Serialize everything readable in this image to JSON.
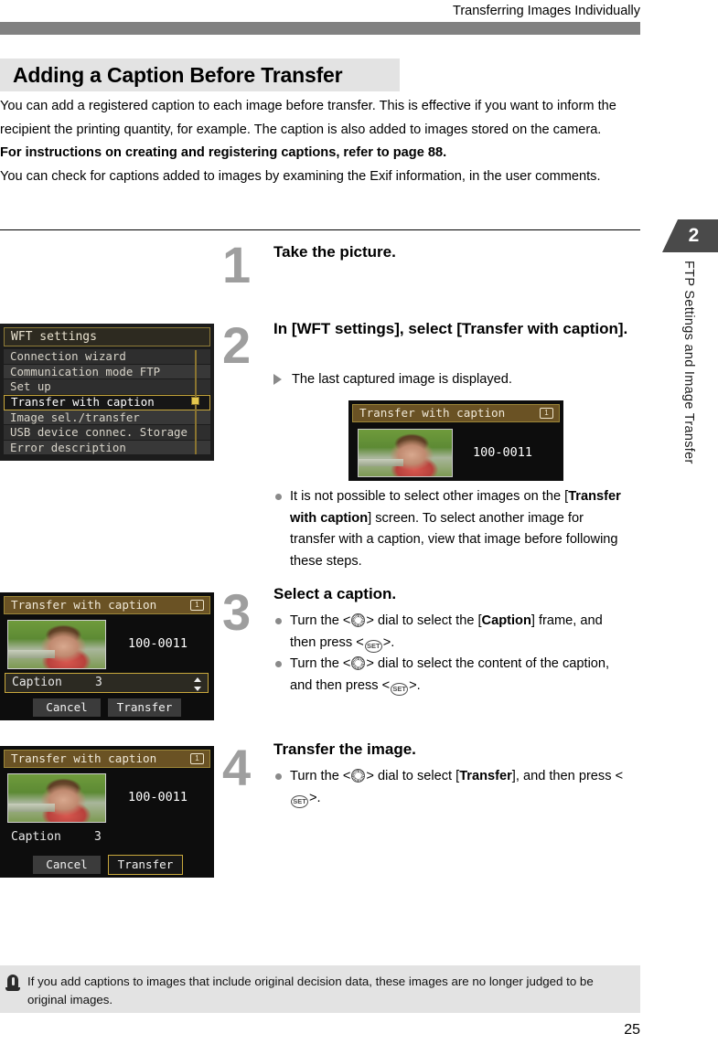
{
  "header": {
    "running_title": "Transferring Images Individually",
    "rule_color": "#818181"
  },
  "side_tab": {
    "chapter_number": "2",
    "chapter_label": "FTP Settings and Image Transfer",
    "bg_color": "#4a4a4a"
  },
  "section": {
    "heading": "Adding a Caption Before Transfer",
    "heading_bg": "#e3e3e3"
  },
  "intro": {
    "line1": "You can add a registered caption to each image before transfer. This is effective if you want to inform the recipient the printing quantity, for example. The caption is also added to images stored on the camera.",
    "line2_bold": "For instructions on creating and registering captions, refer to page 88.",
    "line3": "You can check for captions added to images by examining the Exif information, in the user comments."
  },
  "steps": [
    {
      "number": "1",
      "title": "Take the picture."
    },
    {
      "number": "2",
      "title_part1": "In [WFT settings], select [Transfer with caption].",
      "arrow_note": "The last captured image is displayed.",
      "bullet_pre": "It is not possible to select other images on the [",
      "bullet_bold": "Transfer with caption",
      "bullet_post": "] screen. To select another image for transfer with a caption, view that image before following these steps."
    },
    {
      "number": "3",
      "title": "Select a caption.",
      "bullet1_a": "Turn the <",
      "bullet1_b": "> dial to select the [",
      "bullet1_bold": "Caption",
      "bullet1_c": "] frame, and then press <",
      "bullet1_d": ">.",
      "bullet2_a": "Turn the <",
      "bullet2_b": "> dial to select the content of the caption, and then press <",
      "bullet2_c": ">."
    },
    {
      "number": "4",
      "title": "Transfer the image.",
      "bullet1_a": "Turn the <",
      "bullet1_b": "> dial to select [",
      "bullet1_bold": "Transfer",
      "bullet1_c": "], and then press <",
      "bullet1_d": ">."
    }
  ],
  "icons": {
    "dial": "quick-control-dial-icon",
    "set": "SET",
    "card_badge": "1",
    "warning": "warning-bell-icon"
  },
  "lcd_wft": {
    "menu_title": "WFT settings",
    "items": [
      "Connection wizard",
      "Communication mode FTP",
      "Set up",
      "Transfer with caption",
      "Image sel./transfer",
      "USB device connec. Storage",
      "Error description"
    ],
    "selected_index": 3,
    "highlight_color": "#c9a83c"
  },
  "lcd_step2": {
    "title": "Transfer with caption",
    "card_badge": "1",
    "filename": "100-0011"
  },
  "lcd_step3": {
    "title": "Transfer with caption",
    "card_badge": "1",
    "filename": "100-0011",
    "caption_label": "Caption",
    "caption_value": "3",
    "caption_focused": true,
    "cancel_label": "Cancel",
    "transfer_label": "Transfer",
    "focused_button": "caption"
  },
  "lcd_step4": {
    "title": "Transfer with caption",
    "card_badge": "1",
    "filename": "100-0011",
    "caption_label": "Caption",
    "caption_value": "3",
    "caption_focused": false,
    "cancel_label": "Cancel",
    "transfer_label": "Transfer",
    "focused_button": "transfer"
  },
  "note": {
    "text": "If you add captions to images that include original decision data, these images are no longer judged to be original images."
  },
  "page_number": "25"
}
